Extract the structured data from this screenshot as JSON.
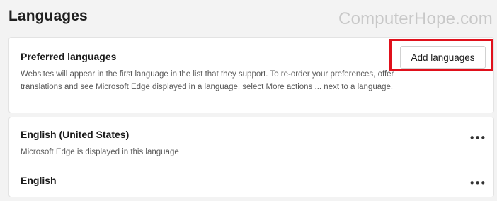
{
  "header": {
    "title": "Languages",
    "watermark": "ComputerHope.com"
  },
  "preferred": {
    "heading": "Preferred languages",
    "description": "Websites will appear in the first language in the list that they support. To re-order your preferences, offer translations and see Microsoft Edge displayed in a language, select More actions ... next to a language.",
    "add_button_label": "Add languages",
    "highlight_color": "#e0101b"
  },
  "languages": [
    {
      "name": "English (United States)",
      "subtitle": "Microsoft Edge is displayed in this language",
      "more_label": "•••"
    },
    {
      "name": "English",
      "subtitle": "",
      "more_label": "•••"
    }
  ]
}
